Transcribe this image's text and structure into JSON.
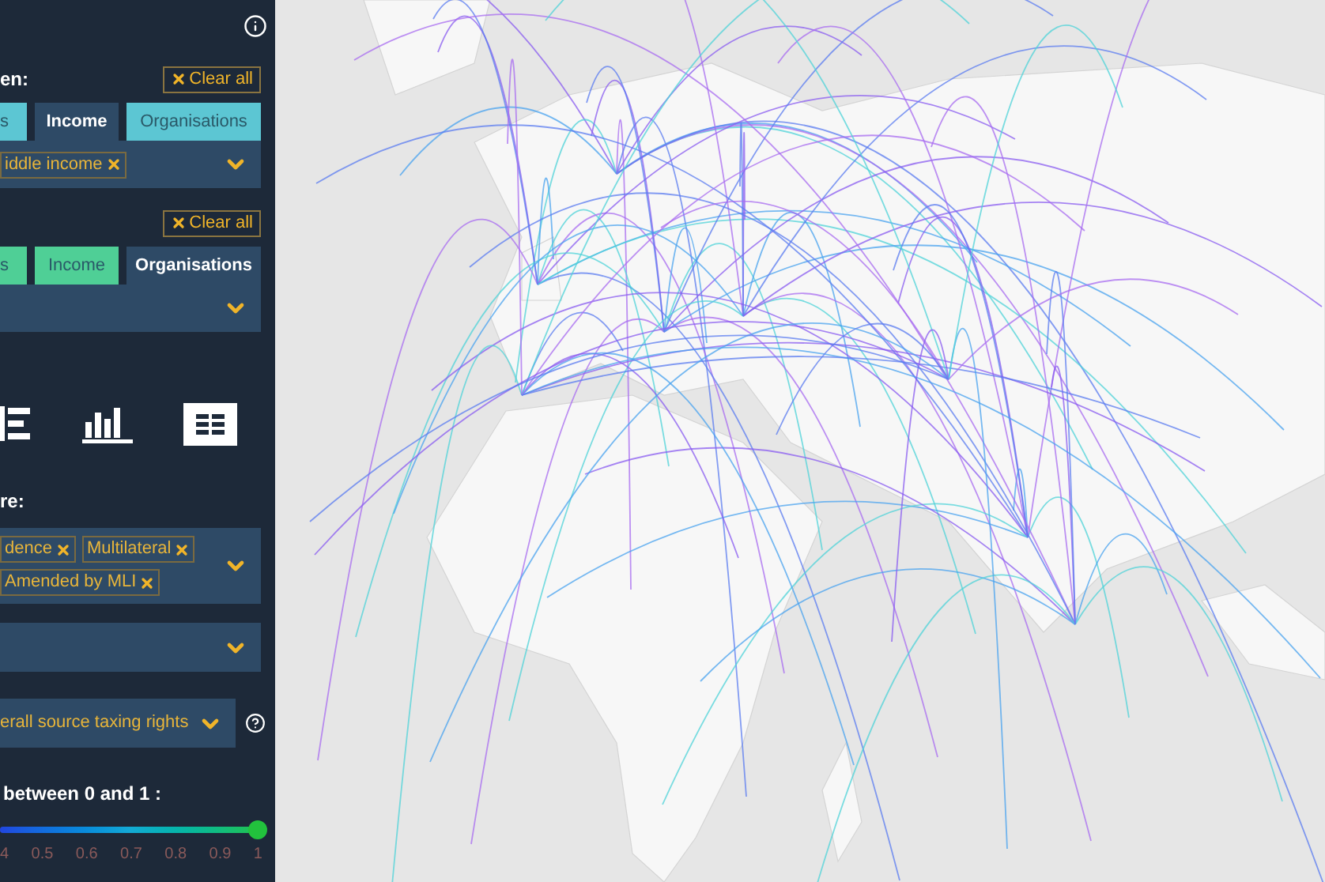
{
  "filters": [
    {
      "heading": "en:",
      "clear_label": "Clear all",
      "color": "#5cc6d3",
      "tabs": [
        {
          "label": "s",
          "selected": false
        },
        {
          "label": "Income",
          "selected": true
        },
        {
          "label": "Organisations",
          "selected": false
        }
      ],
      "tags": [
        "iddle income"
      ]
    },
    {
      "clear_label": "Clear all",
      "color": "#4fcf96",
      "tabs": [
        {
          "label": "s",
          "selected": false
        },
        {
          "label": "Income",
          "selected": false
        },
        {
          "label": "Organisations",
          "selected": true
        }
      ]
    }
  ],
  "views": [
    {
      "kind": "bars-horizontal",
      "selected": false
    },
    {
      "kind": "bars-vertical",
      "selected": false
    },
    {
      "kind": "table",
      "selected": true
    }
  ],
  "treaty_heading": "re:",
  "treaty_tags": [
    "dence",
    "Multilateral",
    "Amended by MLI"
  ],
  "measure": {
    "value": "erall source taxing rights"
  },
  "range": {
    "label": "between 0 and 1 :",
    "level": 1,
    "ticks": [
      "4",
      "0.5",
      "0.6",
      "0.7",
      "0.8",
      "0.9",
      "1"
    ]
  }
}
